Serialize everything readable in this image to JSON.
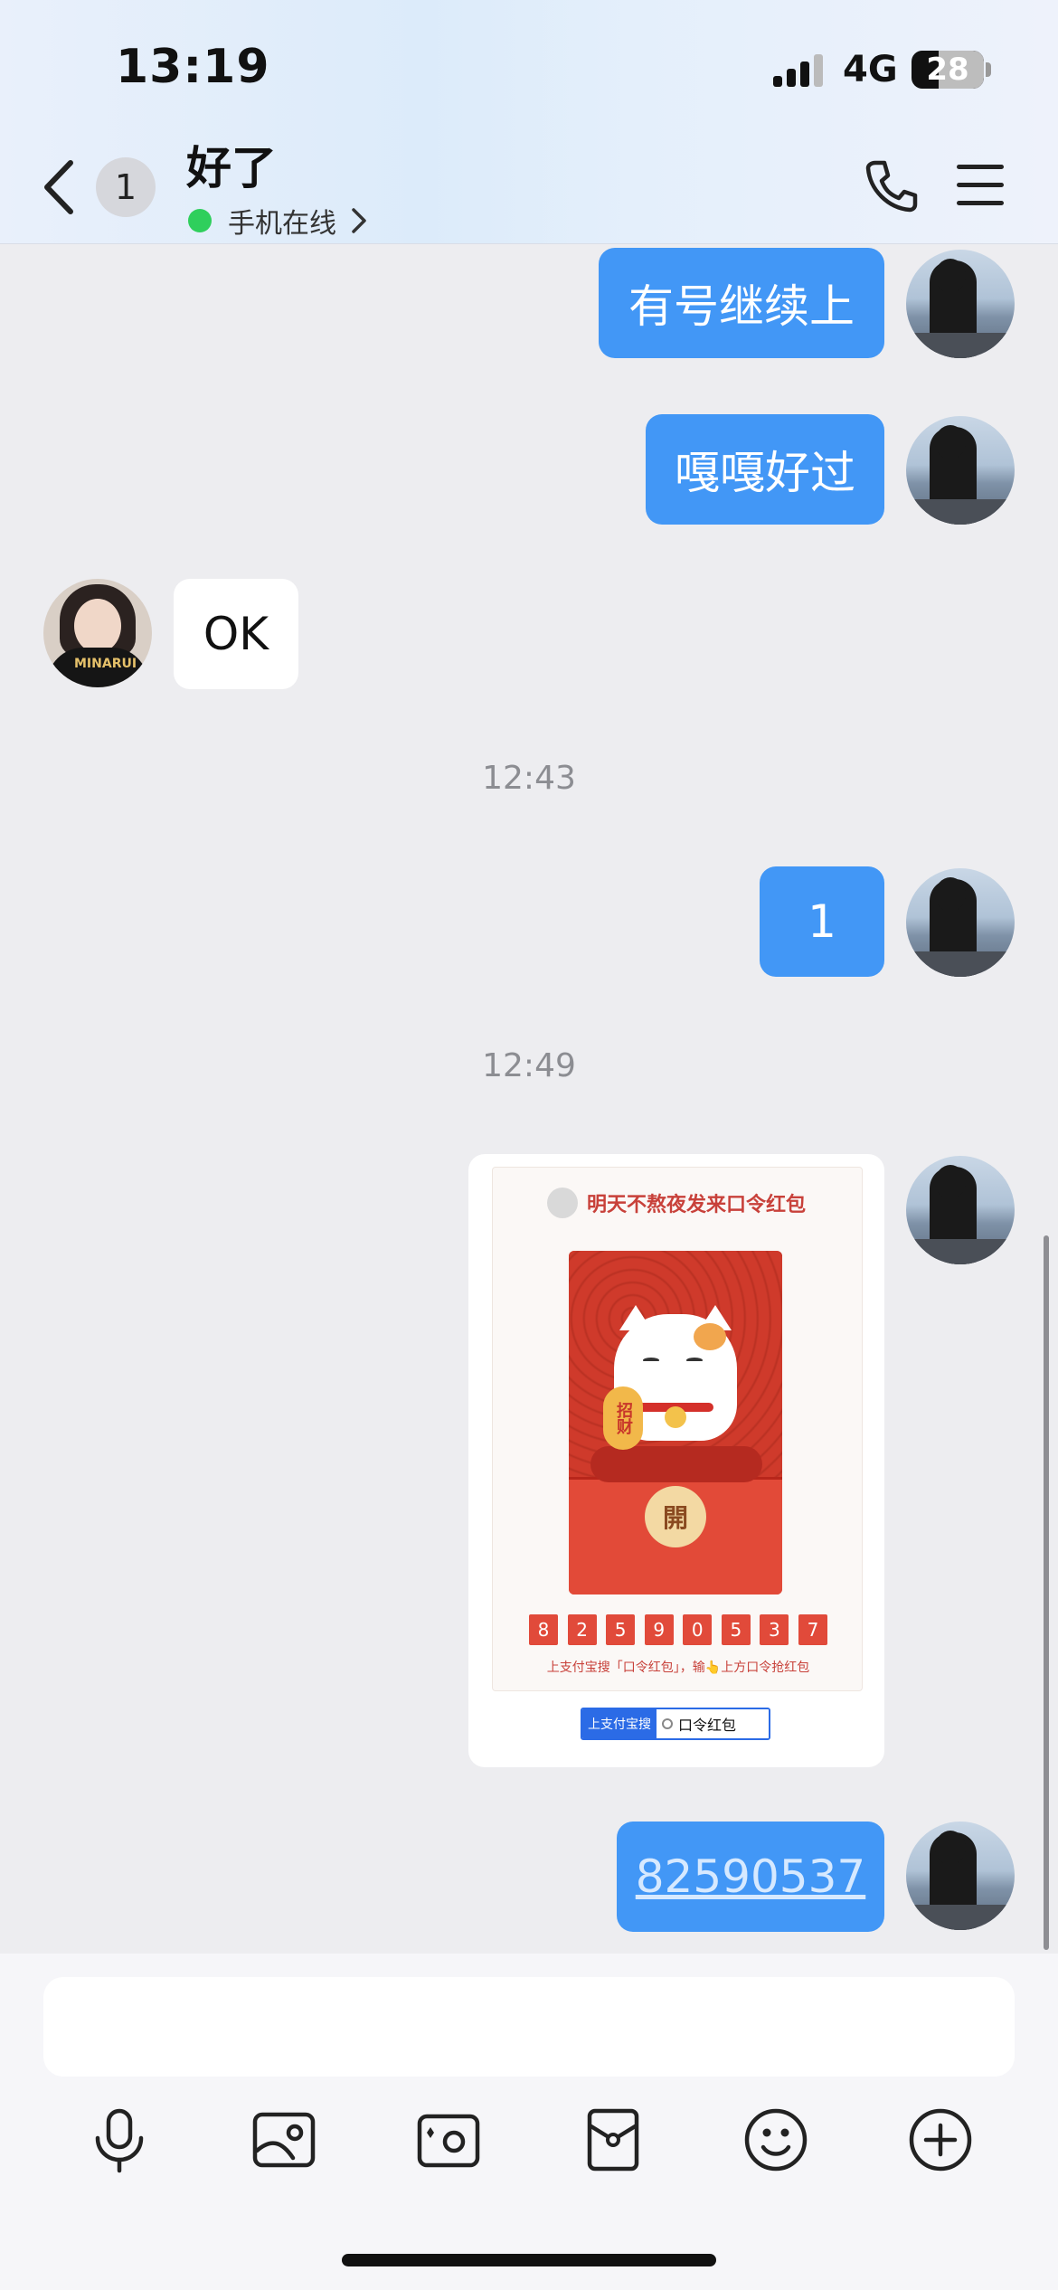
{
  "status_bar": {
    "time": "13:19",
    "network": "4G",
    "battery": "28"
  },
  "header": {
    "unread_count": "1",
    "title": "好了",
    "status_text": "手机在线",
    "status_color": "#2fcf5c"
  },
  "messages": [
    {
      "side": "out",
      "text": "有号继续上"
    },
    {
      "side": "out",
      "text": "嘎嘎好过"
    },
    {
      "side": "in",
      "text": "OK"
    },
    {
      "type": "time",
      "text": "12:43"
    },
    {
      "side": "out",
      "text": "1"
    },
    {
      "type": "time",
      "text": "12:49"
    },
    {
      "side": "out",
      "type": "card"
    },
    {
      "side": "out",
      "text": "82590537"
    }
  ],
  "card": {
    "title": "明天不熬夜发来口令红包",
    "coin_text": "招财",
    "open_text": "開",
    "code_digits": [
      "8",
      "2",
      "5",
      "9",
      "0",
      "5",
      "3",
      "7"
    ],
    "hint": "上支付宝搜「口令红包」，输👆上方口令抢红包",
    "search_label": "上支付宝搜",
    "search_term": "口令红包"
  },
  "avatar_other_shirt": "MINARUI",
  "toolbar": {
    "icons": [
      "microphone-icon",
      "image-icon",
      "camera-icon",
      "red-packet-icon",
      "emoji-icon",
      "plus-icon"
    ]
  },
  "colors": {
    "bubble_out": "#4297f6",
    "bubble_in": "#ffffff",
    "background": "#ededf0"
  }
}
